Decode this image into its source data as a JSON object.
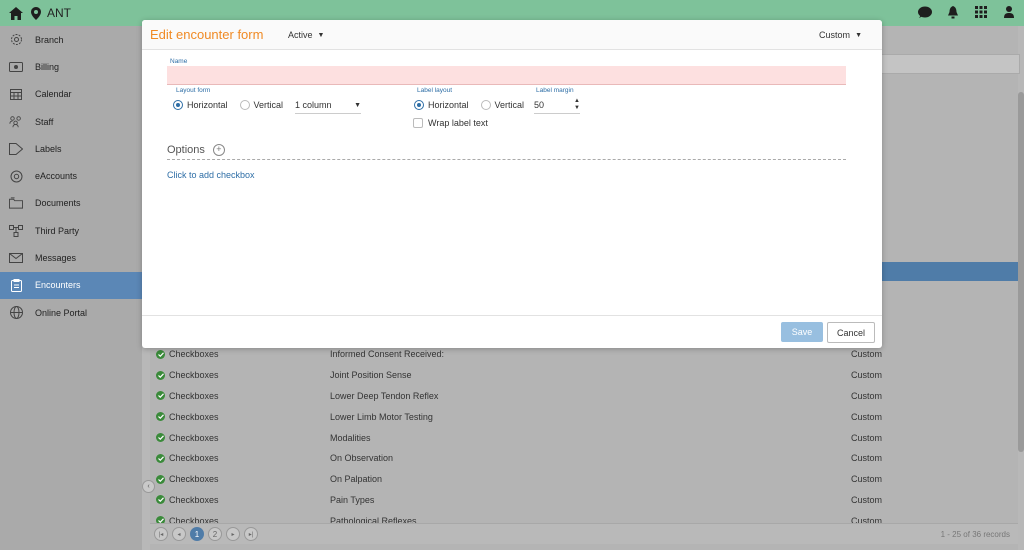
{
  "topbar": {
    "clinic": "ANT",
    "accent_color": "#7ec29a",
    "icons": [
      "home-icon",
      "location-pin-icon",
      "chat-icon",
      "bell-icon",
      "apps-grid-icon",
      "user-icon"
    ]
  },
  "sidebar": {
    "items": [
      {
        "label": "Branch",
        "icon": "gear-icon"
      },
      {
        "label": "Billing",
        "icon": "money-icon"
      },
      {
        "label": "Calendar",
        "icon": "calendar-icon"
      },
      {
        "label": "Staff",
        "icon": "staff-icon"
      },
      {
        "label": "Labels",
        "icon": "tag-icon"
      },
      {
        "label": "eAccounts",
        "icon": "at-icon"
      },
      {
        "label": "Documents",
        "icon": "folder-icon"
      },
      {
        "label": "Third Party",
        "icon": "network-icon"
      },
      {
        "label": "Messages",
        "icon": "envelope-icon"
      },
      {
        "label": "Encounters",
        "icon": "clipboard-icon",
        "active": true
      },
      {
        "label": "Online Portal",
        "icon": "globe-icon"
      }
    ],
    "active_color": "#5b87b6"
  },
  "modal": {
    "title": "Edit encounter form",
    "status": "Active",
    "category": "Custom",
    "name_label": "Name",
    "name_value": "",
    "layout_form_label": "Layout form",
    "layout_horizontal": "Horizontal",
    "layout_vertical": "Vertical",
    "columns": "1 column",
    "label_layout_label": "Label layout",
    "label_horizontal": "Horizontal",
    "label_vertical": "Vertical",
    "label_margin_label": "Label margin",
    "label_margin_value": "50",
    "wrap_label": "Wrap label text",
    "options_label": "Options",
    "add_checkbox": "Click to add checkbox",
    "save": "Save",
    "cancel": "Cancel",
    "title_color": "#f08a24"
  },
  "list": {
    "rows": [
      {
        "type": "Checkboxes",
        "name": "Informed Consent Received:",
        "category": "Custom"
      },
      {
        "type": "Checkboxes",
        "name": "Joint Position Sense",
        "category": "Custom"
      },
      {
        "type": "Checkboxes",
        "name": "Lower Deep Tendon Reflex",
        "category": "Custom"
      },
      {
        "type": "Checkboxes",
        "name": "Lower Limb Motor Testing",
        "category": "Custom"
      },
      {
        "type": "Checkboxes",
        "name": "Modalities",
        "category": "Custom"
      },
      {
        "type": "Checkboxes",
        "name": "On Observation",
        "category": "Custom"
      },
      {
        "type": "Checkboxes",
        "name": "On Palpation",
        "category": "Custom"
      },
      {
        "type": "Checkboxes",
        "name": "Pain Types",
        "category": "Custom"
      },
      {
        "type": "Checkboxes",
        "name": "Pathological Reflexes",
        "category": "Custom"
      }
    ],
    "pager": {
      "current_page": "1",
      "next_page": "2",
      "records": "1 - 25 of 36 records"
    }
  }
}
